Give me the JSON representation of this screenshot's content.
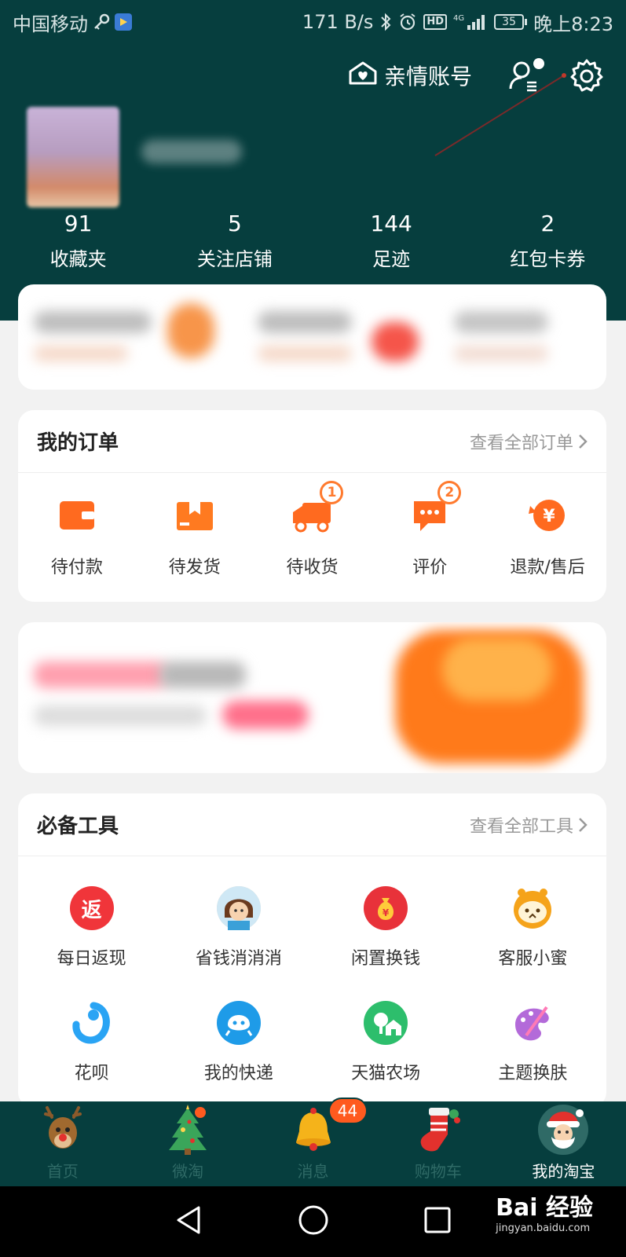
{
  "status_bar": {
    "carrier": "中国移动",
    "speed": "171 B/s",
    "network": "4G",
    "battery": "35",
    "time": "晚上8:23"
  },
  "header": {
    "family_account": "亲情账号"
  },
  "stats": [
    {
      "value": "91",
      "label": "收藏夹"
    },
    {
      "value": "5",
      "label": "关注店铺"
    },
    {
      "value": "144",
      "label": "足迹"
    },
    {
      "value": "2",
      "label": "红包卡券"
    }
  ],
  "orders": {
    "title": "我的订单",
    "more": "查看全部订单",
    "items": [
      {
        "label": "待付款",
        "badge": ""
      },
      {
        "label": "待发货",
        "badge": ""
      },
      {
        "label": "待收货",
        "badge": "1"
      },
      {
        "label": "评价",
        "badge": "2"
      },
      {
        "label": "退款/售后",
        "badge": ""
      }
    ]
  },
  "tools": {
    "title": "必备工具",
    "more": "查看全部工具",
    "items": [
      {
        "label": "每日返现",
        "glyph": "返",
        "icon": "cashback-icon",
        "color": "#f0353a"
      },
      {
        "label": "省钱消消消",
        "glyph": "",
        "icon": "game-avatar-icon",
        "color": "#f3c89a"
      },
      {
        "label": "闲置换钱",
        "glyph": "¥",
        "icon": "money-bag-icon",
        "color": "#e8323a"
      },
      {
        "label": "客服小蜜",
        "glyph": "",
        "icon": "assistant-icon",
        "color": "#f5a31a"
      },
      {
        "label": "花呗",
        "glyph": "",
        "icon": "huabei-icon",
        "color": "#2aa4f4"
      },
      {
        "label": "我的快递",
        "glyph": "",
        "icon": "courier-icon",
        "color": "#1e9be8"
      },
      {
        "label": "天猫农场",
        "glyph": "",
        "icon": "farm-icon",
        "color": "#2dbe6c"
      },
      {
        "label": "主题换肤",
        "glyph": "",
        "icon": "theme-icon",
        "color": "#b36ad9"
      }
    ]
  },
  "tabbar": {
    "items": [
      {
        "label": "首页"
      },
      {
        "label": "微淘"
      },
      {
        "label": "消息",
        "badge": "44"
      },
      {
        "label": "购物车"
      },
      {
        "label": "我的淘宝"
      }
    ]
  },
  "watermark": {
    "main": "Bai 经验",
    "sub": "jingyan.baidu.com"
  }
}
